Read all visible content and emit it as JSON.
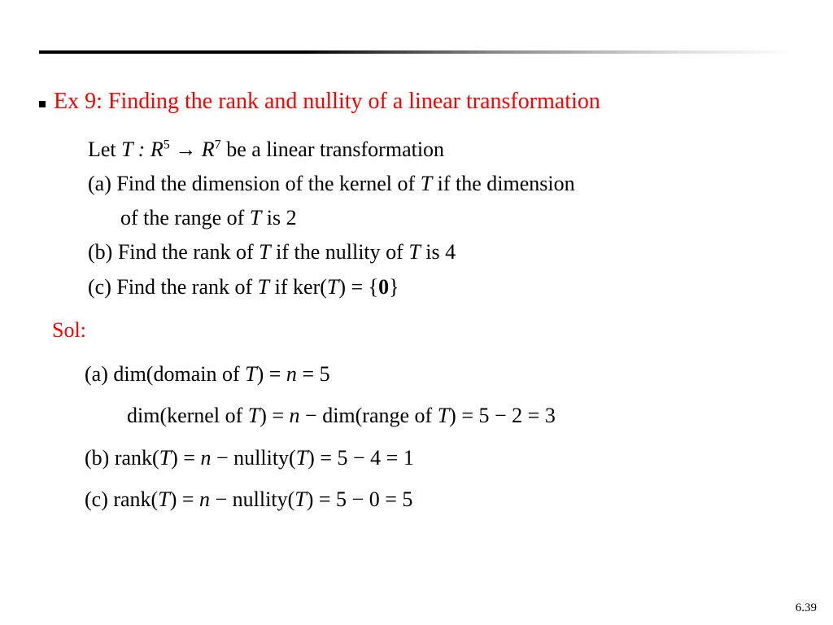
{
  "title": "Ex 9: Finding the rank and nullity of a linear transformation",
  "let_prefix": "Let ",
  "let_T": "T",
  "let_colon_R": " : R",
  "exp5": "5",
  "arrow": " → ",
  "R": "R",
  "exp7": "7",
  "let_suffix": " be a linear transformation",
  "a_label": "(a) ",
  "a_line1_pre": "Find the dimension of the kernel of ",
  "a_line1_post": " if the dimension",
  "a_line2_pre": "of the range of ",
  "a_line2_post": " is 2",
  "b_label": "(b) ",
  "b_pre": "Find the rank of ",
  "b_mid": " if the nullity of ",
  "b_post": " is 4",
  "c_label": "(c) ",
  "c_pre": "Find the rank of ",
  "c_mid": " if ker(",
  "c_post": ") = {",
  "zero": "0",
  "brace_close": "}",
  "sol_label": "Sol:",
  "sa_label": "(a)  ",
  "sa_line1_pre": "dim(domain of ",
  "sa_line1_post": ") = ",
  "n": "n",
  "eq5": " = 5",
  "sa_line2_pre": "dim(kernel of ",
  "sa_line2_mid": ") = ",
  "sa_line2_mid2": " − dim(range of ",
  "sa_line2_post": ") = 5 − 2 = 3",
  "sb_label": "(b) ",
  "sb_pre": "rank(",
  "sb_mid": ") = ",
  "sb_mid2": " − nullity(",
  "sb_post": ") = 5 − 4 = 1",
  "sc_label": "(c) ",
  "sc_pre": "rank(",
  "sc_mid": ") = ",
  "sc_mid2": " − nullity(",
  "sc_post": ") = 5 − 0 = 5",
  "pagenum": "6.39"
}
